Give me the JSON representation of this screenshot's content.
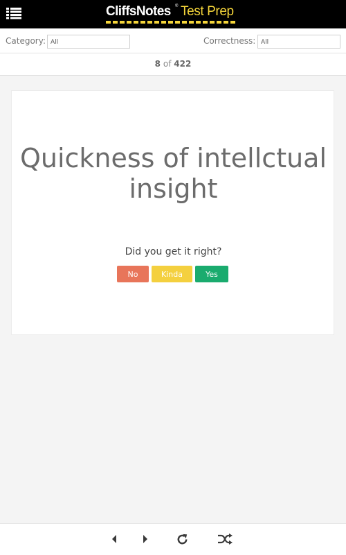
{
  "header": {
    "brand": "CliffsNotes",
    "registered_mark": "®",
    "product": "Test Prep",
    "menu_icon": "hamburger-list-icon"
  },
  "filters": {
    "category_label": "Category:",
    "category_value": "All",
    "correctness_label": "Correctness:",
    "correctness_value": "All"
  },
  "counter": {
    "current": "8",
    "of": "of",
    "total": "422"
  },
  "card": {
    "term": "Quickness of intellctual insight",
    "question": "Did you get it right?",
    "buttons": {
      "no": "No",
      "kinda": "Kinda",
      "yes": "Yes"
    }
  },
  "colors": {
    "header_bg": "#000000",
    "brand_accent": "#f5d53a",
    "no": "#e8755a",
    "kinda": "#f4d03f",
    "yes": "#1aab6e"
  },
  "toolbar": {
    "icons": [
      "previous-icon",
      "next-icon",
      "refresh-icon",
      "shuffle-icon"
    ]
  }
}
